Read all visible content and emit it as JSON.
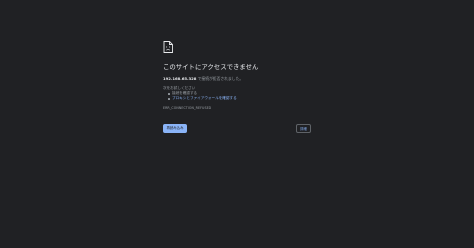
{
  "error": {
    "icon": "sad-document-icon",
    "heading": "このサイトにアクセスできません",
    "host": "192.168.65.328",
    "host_message": " で接続が拒否されました。",
    "try_label": "次をお試しください",
    "suggestions": [
      {
        "label": "接続を確認する",
        "link": false
      },
      {
        "label": "プロキシとファイアウォールを確認する",
        "link": true
      }
    ],
    "code": "ERR_CONNECTION_REFUSED"
  },
  "buttons": {
    "reload_label": "再読み込み",
    "details_label": "詳細"
  },
  "colors": {
    "background": "#202124",
    "heading": "#e8eaed",
    "body_text": "#9aa0a6",
    "link": "#8ab4f8",
    "primary_button": "#8ab4f8"
  }
}
